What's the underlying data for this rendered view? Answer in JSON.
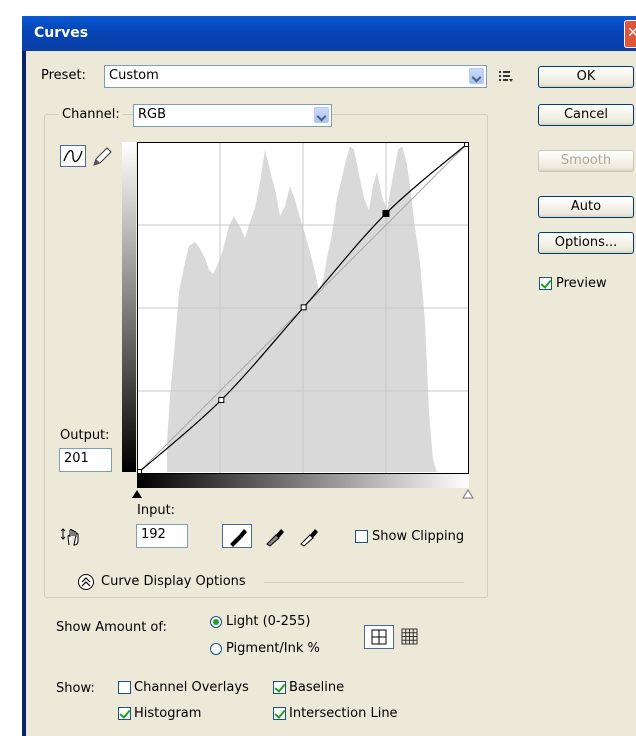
{
  "window": {
    "title": "Curves",
    "close_glyph": "✕"
  },
  "preset": {
    "label": "Preset:",
    "value": "Custom"
  },
  "channel": {
    "label": "Channel:",
    "value": "RGB"
  },
  "buttons": {
    "ok": "OK",
    "cancel": "Cancel",
    "smooth": "Smooth",
    "auto": "Auto",
    "options": "Options..."
  },
  "preview": {
    "label": "Preview",
    "checked": true
  },
  "output": {
    "label": "Output:",
    "value": "201"
  },
  "input": {
    "label": "Input:",
    "value": "192"
  },
  "show_clipping": {
    "label": "Show Clipping",
    "checked": false
  },
  "curve_display": {
    "label": "Curve Display Options"
  },
  "show_amount": {
    "label": "Show Amount of:",
    "light": "Light  (0-255)",
    "pigment": "Pigment/Ink %",
    "selected": "light"
  },
  "show": {
    "label": "Show:",
    "channel_overlays": "Channel Overlays",
    "baseline": "Baseline",
    "histogram": "Histogram",
    "intersection_line": "Intersection Line",
    "checked": {
      "channel_overlays": false,
      "baseline": true,
      "histogram": true,
      "intersection_line": true
    }
  },
  "curve_points": [
    [
      0,
      0
    ],
    [
      64,
      56
    ],
    [
      128,
      128
    ],
    [
      192,
      201
    ],
    [
      255,
      255
    ]
  ],
  "colors": {
    "title_bar": "#0545b7",
    "dialog_bg": "#ece9d8",
    "histogram": "#d9d9d9",
    "grid": "#c8c8c8"
  }
}
